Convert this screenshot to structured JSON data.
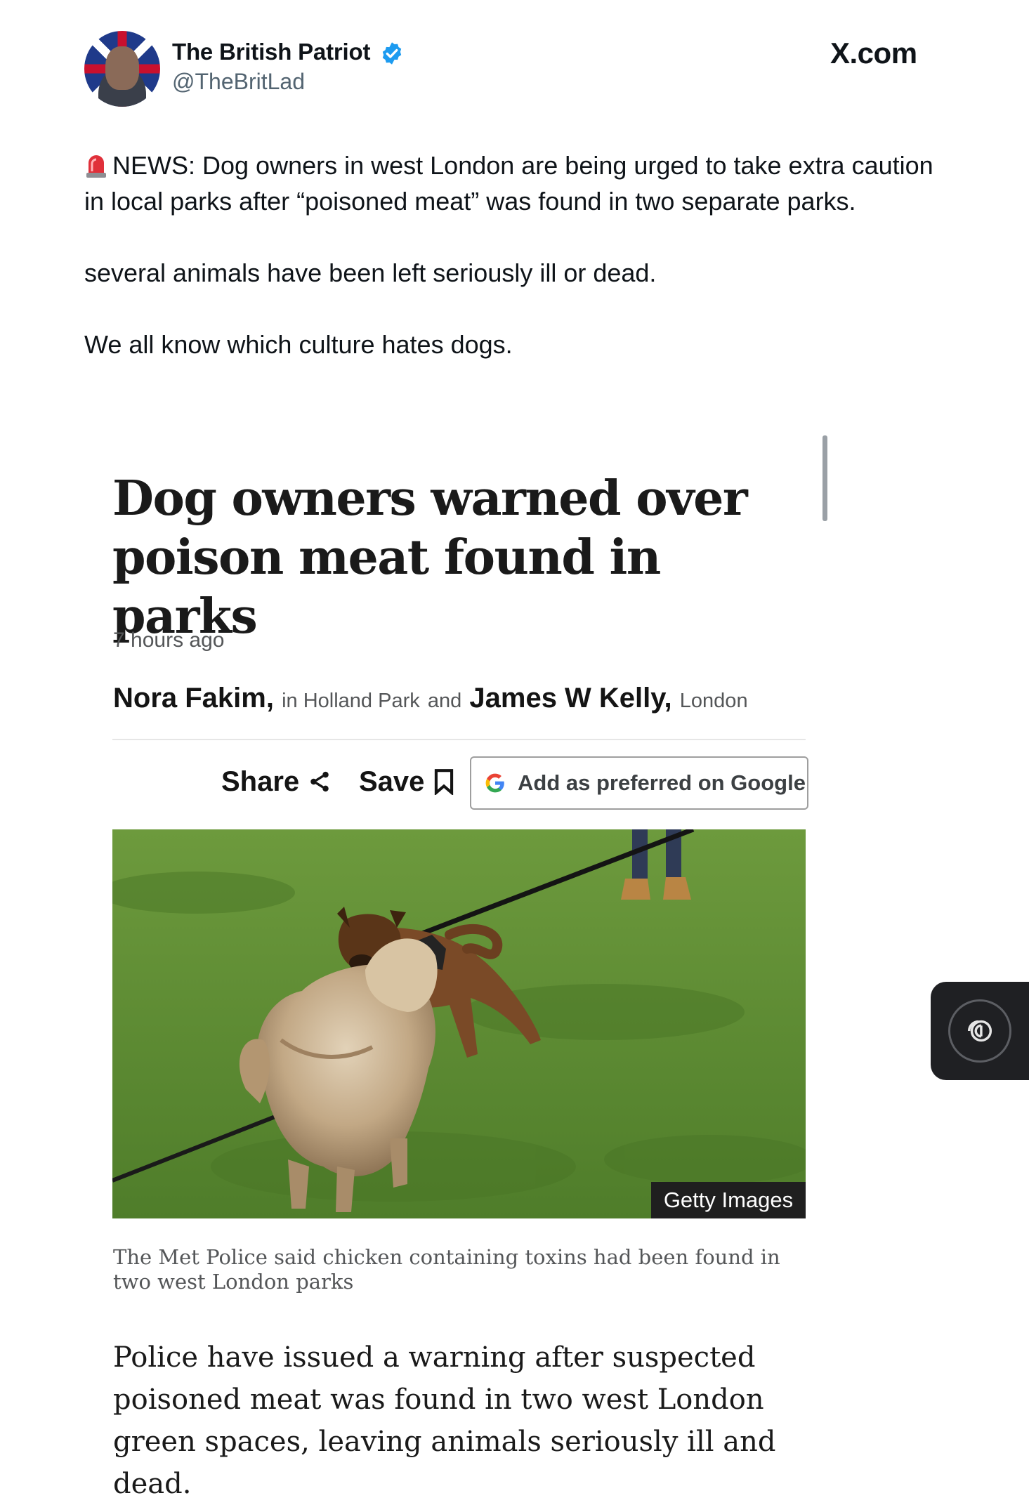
{
  "tweet": {
    "author_name": "The British Patriot",
    "author_handle": "@TheBritLad",
    "site_label": "X.com",
    "paragraphs": [
      "NEWS: Dog owners in west London are being urged to take extra caution in local parks after “poisoned meat” was found in two separate parks.",
      "several animals have been left seriously ill or dead.",
      "We all know which culture hates dogs."
    ]
  },
  "article": {
    "headline": "Dog owners warned over poison meat found in parks",
    "timestamp": "7 hours ago",
    "byline": {
      "author1": "Nora Fakim,",
      "location1": "in Holland Park",
      "conjunction": "and",
      "author2": "James W Kelly,",
      "location2": "London"
    },
    "actions": {
      "share_label": "Share",
      "save_label": "Save",
      "google_label": "Add as preferred on Google"
    },
    "image_credit": "Getty Images",
    "caption": "The Met Police said chicken containing toxins had been found in two west London parks",
    "lede": "Police have issued a warning after suspected poisoned meat was found in two west London green spaces, leaving animals seriously ill and dead."
  },
  "icons": {
    "verified": "verified-badge-icon",
    "siren": "siren-emoji-icon",
    "share": "share-icon",
    "save": "bookmark-icon",
    "google": "google-g-icon",
    "floating": "ai-assistant-icon"
  },
  "colors": {
    "verified_blue": "#1d9bf0",
    "text_primary": "#0f1419",
    "text_secondary": "#536471",
    "grass": "#5c8c33"
  }
}
